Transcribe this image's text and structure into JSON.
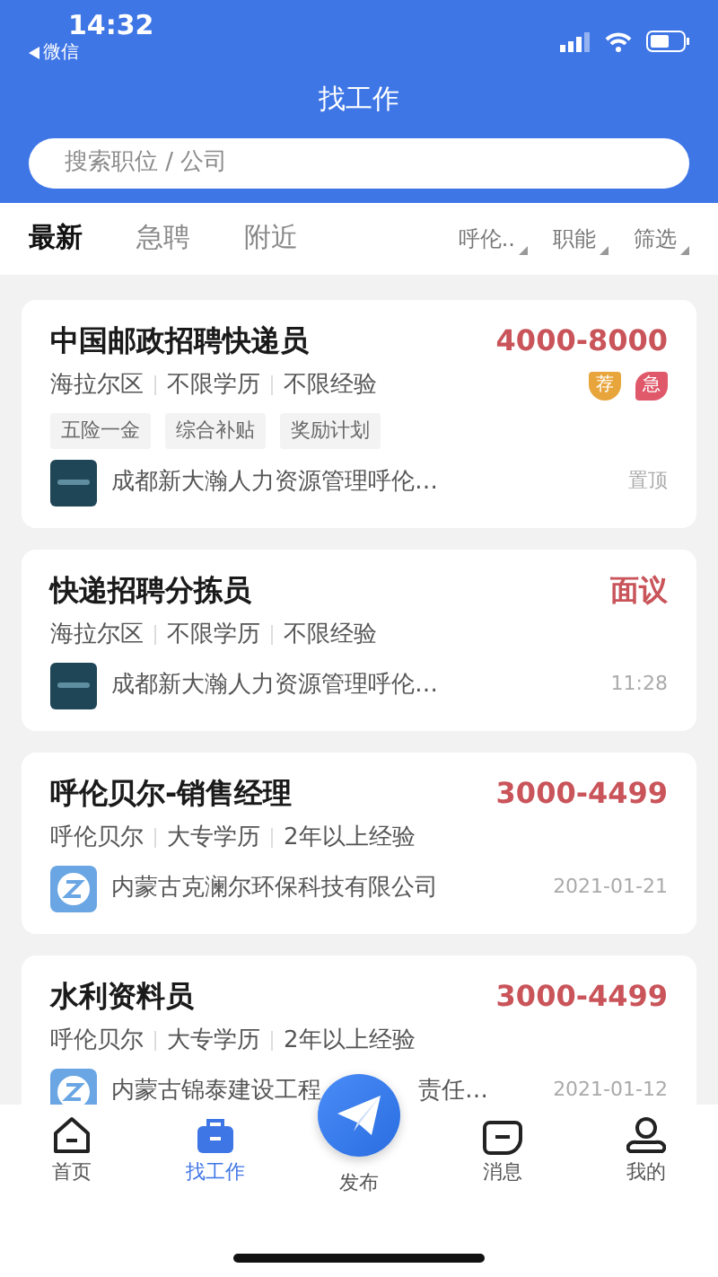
{
  "status_bar": {
    "time": "14:32",
    "back_label": "微信"
  },
  "header": {
    "title": "找工作"
  },
  "search": {
    "placeholder": "搜索职位 / 公司"
  },
  "tabs": [
    {
      "label": "最新",
      "selected": true
    },
    {
      "label": "急聘",
      "selected": false
    },
    {
      "label": "附近",
      "selected": false
    }
  ],
  "filters": [
    "呼伦..",
    "职能",
    "筛选"
  ],
  "jobs": [
    {
      "title": "中国邮政招聘快递员",
      "salary": "4000-8000",
      "meta": [
        "海拉尔区",
        "不限学历",
        "不限经验"
      ],
      "badges": [
        {
          "kind": "recommend",
          "text": "荐"
        },
        {
          "kind": "urgent",
          "text": "急"
        }
      ],
      "tags": [
        "五险一金",
        "综合补贴",
        "奖励计划"
      ],
      "logo": {
        "kind": "dark"
      },
      "company": "成都新大瀚人力资源管理呼伦…",
      "time": "置顶"
    },
    {
      "title": "快递招聘分拣员",
      "salary": "面议",
      "meta": [
        "海拉尔区",
        "不限学历",
        "不限经验"
      ],
      "logo": {
        "kind": "dark"
      },
      "company": "成都新大瀚人力资源管理呼伦…",
      "time": "11:28"
    },
    {
      "title": "呼伦贝尔-销售经理",
      "salary": "3000-4499",
      "meta": [
        "呼伦贝尔",
        "大专学历",
        "2年以上经验"
      ],
      "logo": {
        "kind": "ring"
      },
      "company": "内蒙古克澜尔环保科技有限公司",
      "time": "2021-01-21"
    },
    {
      "title": "水利资料员",
      "salary": "3000-4499",
      "meta": [
        "呼伦贝尔",
        "大专学历",
        "2年以上经验"
      ],
      "logo": {
        "kind": "ring"
      },
      "company": "内蒙古锦泰建设工程",
      "company_tail": "责任…",
      "time": "2021-01-12"
    }
  ],
  "bottom_nav": [
    {
      "kind": "home",
      "label": "首页",
      "selected": false
    },
    {
      "kind": "briefcase",
      "label": "找工作",
      "selected": true
    },
    {
      "kind": "send",
      "label": "发布",
      "selected": false
    },
    {
      "kind": "chat",
      "label": "消息",
      "selected": false
    },
    {
      "kind": "person",
      "label": "我的",
      "selected": false
    }
  ]
}
